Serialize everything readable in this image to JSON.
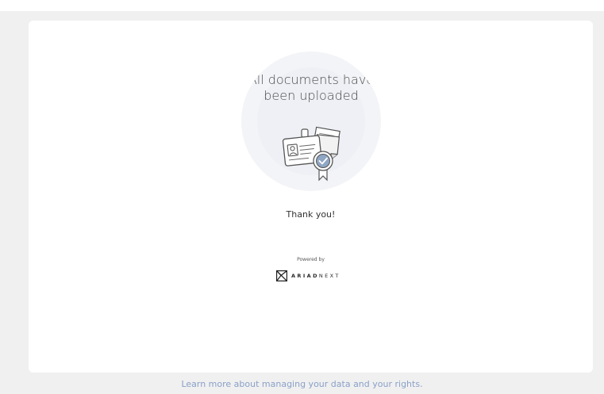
{
  "status": {
    "title": "All documents have been uploaded",
    "illustration_icon": "id-card-with-certificate-badge-icon"
  },
  "message": {
    "thanks": "Thank you!"
  },
  "branding": {
    "powered_by": "Powered by",
    "brand_bold": "ARIAD",
    "brand_light": "NEXT",
    "logo_icon": "ariadnext-logo-icon"
  },
  "footer": {
    "link_text": "Learn more about managing your data and your rights."
  },
  "colors": {
    "page_background": "#f0f0f0",
    "card_background": "#ffffff",
    "link": "#8aa0c8",
    "badge": "#8fa6c4"
  }
}
